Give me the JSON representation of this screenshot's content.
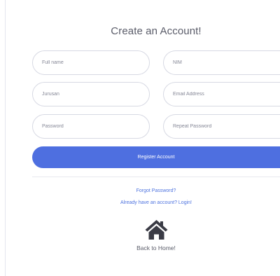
{
  "title": "Create an Account!",
  "form": {
    "full_name_placeholder": "Full name",
    "nim_placeholder": "NIM",
    "jurusan_placeholder": "Jurusan",
    "email_placeholder": "Email Address",
    "password_placeholder": "Password",
    "repeat_password_placeholder": "Repeat Password",
    "register_label": "Register Account"
  },
  "links": {
    "forgot_password": "Forgot Password?",
    "login": "Already have an account? Login!",
    "back_home": "Back to Home!"
  },
  "icons": {
    "home": "home-icon"
  },
  "colors": {
    "accent": "#4e6fe0",
    "link": "#4e73df",
    "text": "#5a5c69",
    "border": "#d7d9e3"
  }
}
